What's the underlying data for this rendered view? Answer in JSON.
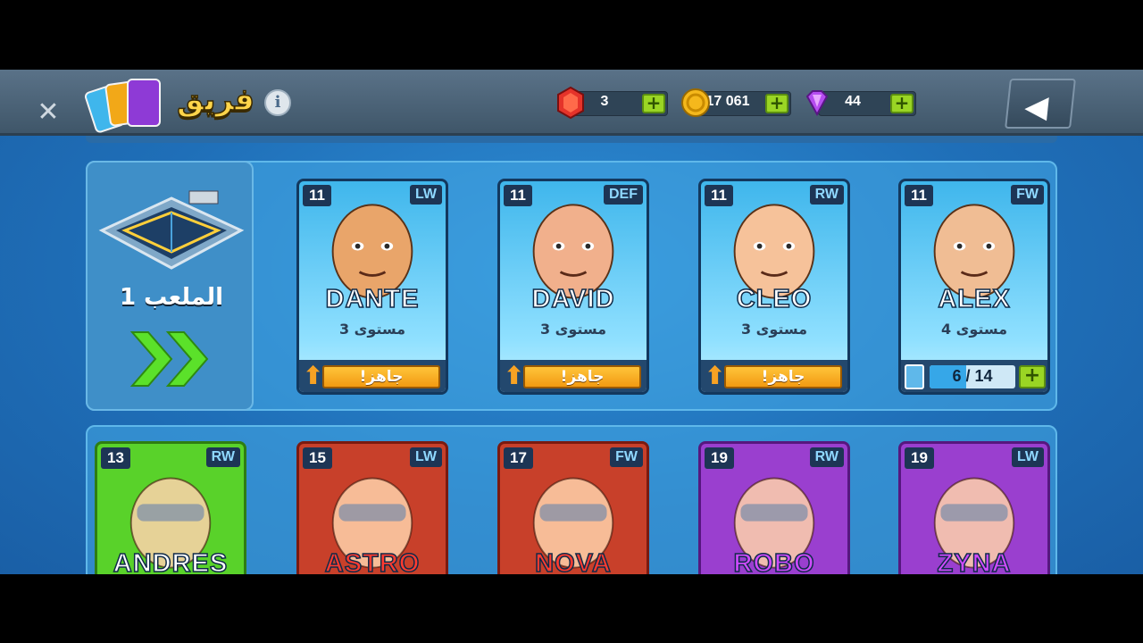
{
  "header": {
    "title": "فريق",
    "info_label": "i",
    "resources": [
      {
        "name": "ruby",
        "value": "3",
        "icon": "red-gem-icon"
      },
      {
        "name": "coins",
        "value": "17 061",
        "icon": "coin-icon"
      },
      {
        "name": "gems",
        "value": "44",
        "icon": "purple-gem-icon"
      }
    ],
    "plus_label": "+"
  },
  "stadium": {
    "label": "الملعب 1"
  },
  "team_cards": [
    {
      "level": "11",
      "position": "LW",
      "name": "DANTE",
      "sublevel": "مستوى 3",
      "status": "جاهز!",
      "bg": "#3fb6ec",
      "skin": "#e9a56a"
    },
    {
      "level": "11",
      "position": "DEF",
      "name": "DAVID",
      "sublevel": "مستوى 3",
      "status": "جاهز!",
      "bg": "#3fb6ec",
      "skin": "#f1b08c"
    },
    {
      "level": "11",
      "position": "RW",
      "name": "CLEO",
      "sublevel": "مستوى 3",
      "status": "جاهز!",
      "bg": "#3fb6ec",
      "skin": "#f6c29a"
    },
    {
      "level": "11",
      "position": "FW",
      "name": "ALEX",
      "sublevel": "مستوى 4",
      "progress_text": "6 / 14",
      "progress": 0.43,
      "bg": "#3fb6ec",
      "skin": "#f0bd94"
    }
  ],
  "roster_cards": [
    {
      "level": "13",
      "position": "RW",
      "name": "ANDRES",
      "bg": "#59d22a",
      "border": "#2e7d12",
      "namecolor": "#ffffff"
    },
    {
      "level": "15",
      "position": "LW",
      "name": "ASTRO",
      "bg": "#c8402a",
      "border": "#7a1a10",
      "namecolor": "#ff3b30"
    },
    {
      "level": "17",
      "position": "FW",
      "name": "NOVA",
      "bg": "#c8402a",
      "border": "#7a1a10",
      "namecolor": "#ff3b30"
    },
    {
      "level": "19",
      "position": "RW",
      "name": "ROBO",
      "bg": "#9a3fcf",
      "border": "#56177f",
      "namecolor": "#d04bff"
    },
    {
      "level": "19",
      "position": "LW",
      "name": "ZYNA",
      "bg": "#9a3fcf",
      "border": "#56177f",
      "namecolor": "#d04bff"
    }
  ],
  "colors": {
    "accent_green": "#9ad524",
    "title_yellow": "#ffd54a"
  }
}
